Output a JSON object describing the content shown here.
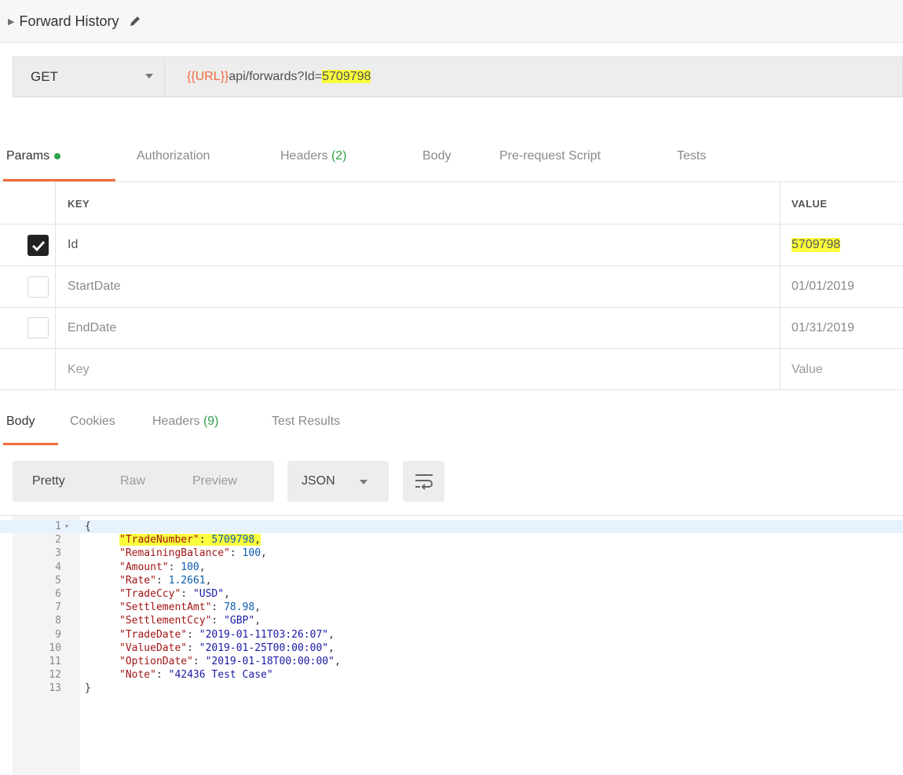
{
  "title": "Forward History",
  "request": {
    "method": "GET",
    "url_variable": "{{URL}}",
    "url_path": "api/forwards?Id=",
    "url_highlight": "5709798"
  },
  "request_tabs": [
    {
      "label": "Params",
      "count": ""
    },
    {
      "label": "Authorization",
      "count": ""
    },
    {
      "label": "Headers",
      "count": "(2)"
    },
    {
      "label": "Body",
      "count": ""
    },
    {
      "label": "Pre-request Script",
      "count": ""
    },
    {
      "label": "Tests",
      "count": ""
    }
  ],
  "params": {
    "header_key": "KEY",
    "header_value": "VALUE",
    "rows": [
      {
        "key": "Id",
        "value": "5709798",
        "checked": true
      },
      {
        "key": "StartDate",
        "value": "01/01/2019",
        "checked": false
      },
      {
        "key": "EndDate",
        "value": "01/31/2019",
        "checked": false
      },
      {
        "key": "Key",
        "value": "Value",
        "checked": false
      }
    ]
  },
  "response_tabs": [
    {
      "label": "Body",
      "count": ""
    },
    {
      "label": "Cookies",
      "count": ""
    },
    {
      "label": "Headers",
      "count": "(9)"
    },
    {
      "label": "Test Results",
      "count": ""
    }
  ],
  "view_modes": [
    "Pretty",
    "Raw",
    "Preview"
  ],
  "format": "JSON",
  "code": {
    "open": "{",
    "close": "}",
    "entries": [
      {
        "key": "\"TradeNumber\"",
        "value": "5709798",
        "kind": "n"
      },
      {
        "key": "\"RemainingBalance\"",
        "value": "100",
        "kind": "n"
      },
      {
        "key": "\"Amount\"",
        "value": "100",
        "kind": "n"
      },
      {
        "key": "\"Rate\"",
        "value": "1.2661",
        "kind": "n"
      },
      {
        "key": "\"TradeCcy\"",
        "value": "\"USD\"",
        "kind": "s"
      },
      {
        "key": "\"SettlementAmt\"",
        "value": "78.98",
        "kind": "n"
      },
      {
        "key": "\"SettlementCcy\"",
        "value": "\"GBP\"",
        "kind": "s"
      },
      {
        "key": "\"TradeDate\"",
        "value": "\"2019-01-11T03:26:07\"",
        "kind": "s"
      },
      {
        "key": "\"ValueDate\"",
        "value": "\"2019-01-25T00:00:00\"",
        "kind": "s"
      },
      {
        "key": "\"OptionDate\"",
        "value": "\"2019-01-18T00:00:00\"",
        "kind": "s"
      },
      {
        "key": "\"Note\"",
        "value": "\"42436 Test Case\"",
        "kind": "s"
      }
    ],
    "line_numbers": [
      "1",
      "2",
      "3",
      "4",
      "5",
      "6",
      "7",
      "8",
      "9",
      "10",
      "11",
      "12",
      "13"
    ]
  }
}
